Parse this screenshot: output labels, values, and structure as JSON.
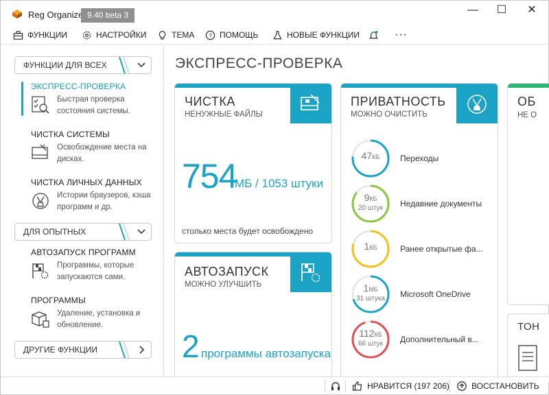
{
  "window": {
    "app_title": "Reg Organizer",
    "version": "9.40 beta 3",
    "minimize": "—",
    "maximize": "☐",
    "close": "✕"
  },
  "menu": {
    "functions": "ФУНКЦИИ",
    "settings": "НАСТРОЙКИ",
    "theme": "ТЕМА",
    "help": "ПОМОЩЬ",
    "new_features": "НОВЫЕ ФУНКЦИИ",
    "more": "···"
  },
  "sidebar": {
    "section_all": "ФУНКЦИИ ДЛЯ ВСЕХ",
    "section_advanced": "ДЛЯ ОПЫТНЫХ",
    "section_other": "ДРУГИЕ ФУНКЦИИ",
    "items": [
      {
        "title": "ЭКСПРЕСС-ПРОВЕРКА",
        "desc": "Быстрая проверка состояния системы."
      },
      {
        "title": "ЧИСТКА СИСТЕМЫ",
        "desc": "Освобождение места на дисках."
      },
      {
        "title": "ЧИСТКА ЛИЧНЫХ ДАННЫХ",
        "desc": "Истории браузеров, кэша программ и др."
      },
      {
        "title": "АВТОЗАПУСК ПРОГРАММ",
        "desc": "Программы, которые запускаются сами."
      },
      {
        "title": "ПРОГРАММЫ",
        "desc": "Удаление, установка и обновление."
      }
    ]
  },
  "main": {
    "title": "ЭКСПРЕСС-ПРОВЕРКА",
    "cleanup": {
      "title": "ЧИСТКА",
      "subtitle": "НЕНУЖНЫЕ ФАЙЛЫ",
      "value": "754",
      "unit": "МБ / 1053 штуки",
      "footer": "столько места будет освобождено"
    },
    "autorun": {
      "title": "АВТОЗАПУСК",
      "subtitle": "МОЖНО УЛУЧШИТЬ",
      "value": "2",
      "unit": "программы автозапуска"
    },
    "privacy": {
      "title": "ПРИВАТНОСТЬ",
      "subtitle": "МОЖНО ОЧИСТИТЬ",
      "rows": [
        {
          "value": "47",
          "unit": "КБ",
          "sub": "",
          "label": "Переходы",
          "color": "#1aa3c5"
        },
        {
          "value": "9",
          "unit": "КБ",
          "sub": "20 штук",
          "label": "Недавние документы",
          "color": "#8cc63f"
        },
        {
          "value": "1",
          "unit": "КБ",
          "sub": "",
          "label": "Ранее открытые фа...",
          "color": "#f2c21b"
        },
        {
          "value": "1",
          "unit": "МБ",
          "sub": "31 штука",
          "label": "Microsoft OneDrive",
          "color": "#1aa3c5"
        },
        {
          "value": "112",
          "unit": "КБ",
          "sub": "66 штук",
          "label": "Дополнительный в...",
          "color": "#e05050"
        }
      ]
    },
    "partial_card_1": {
      "title": "ОБ",
      "subtitle": "НЕ О"
    },
    "partial_card_2": {
      "title": "ТОН"
    }
  },
  "statusbar": {
    "likes": "НРАВИТСЯ (197 206)",
    "restore": "ВОССТАНОВИТЬ"
  }
}
